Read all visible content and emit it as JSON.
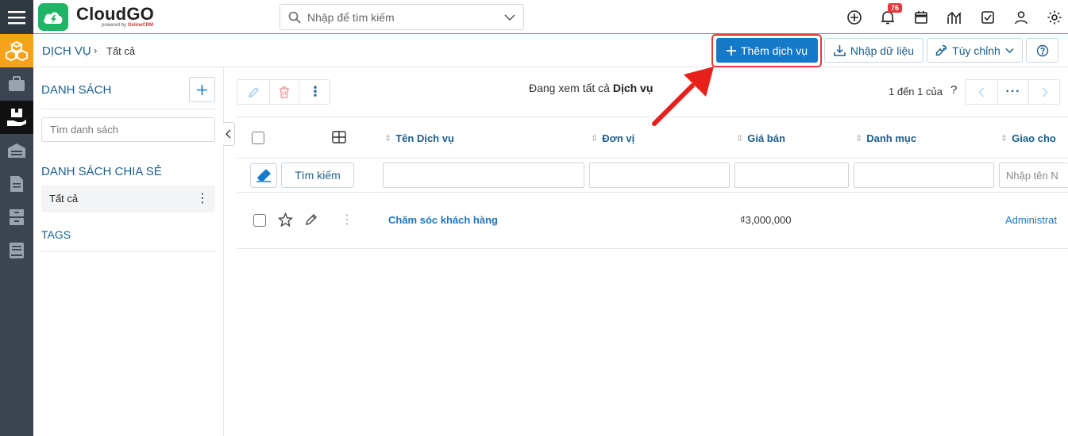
{
  "header": {
    "brand": "CloudGO",
    "brand_sub_prefix": "powered by",
    "brand_sub_name": "OnlineCRM",
    "search_placeholder": "Nhập để tìm kiếm",
    "notification_count": "76"
  },
  "breadcrumb": {
    "module": "DỊCH VỤ",
    "separator": "›",
    "current": "Tất cả"
  },
  "actions": {
    "add_service": "Thêm dịch vụ",
    "import_data": "Nhập dữ liệu",
    "customize": "Tùy chỉnh"
  },
  "sidebar": {
    "list_title": "DANH SÁCH",
    "search_placeholder": "Tìm danh sách",
    "shared_title": "DANH SÁCH CHIA SẺ",
    "items": [
      {
        "label": "Tất cả"
      }
    ],
    "tags_title": "TAGS"
  },
  "main": {
    "view_prefix": "Đang xem tất cả",
    "view_module": "Dịch vụ",
    "pager_text": "1 đến 1 của",
    "pager_unknown": "?",
    "columns": [
      "Tên Dịch vụ",
      "Đơn vị",
      "Giá bán",
      "Danh mục",
      "Giao cho"
    ],
    "search_button": "Tìm kiếm",
    "assignee_filter_placeholder": "Nhập tên N",
    "rows": [
      {
        "name": "Chăm sóc khách hàng",
        "unit": "",
        "price": "₫3,000,000",
        "category": "",
        "assigned_to": "Administrat"
      }
    ]
  },
  "colors": {
    "accent": "#1479c9",
    "brand_green": "#1fb566",
    "rail": "#3b4450",
    "rail_active": "#f7a21b",
    "highlight": "#e53935"
  }
}
